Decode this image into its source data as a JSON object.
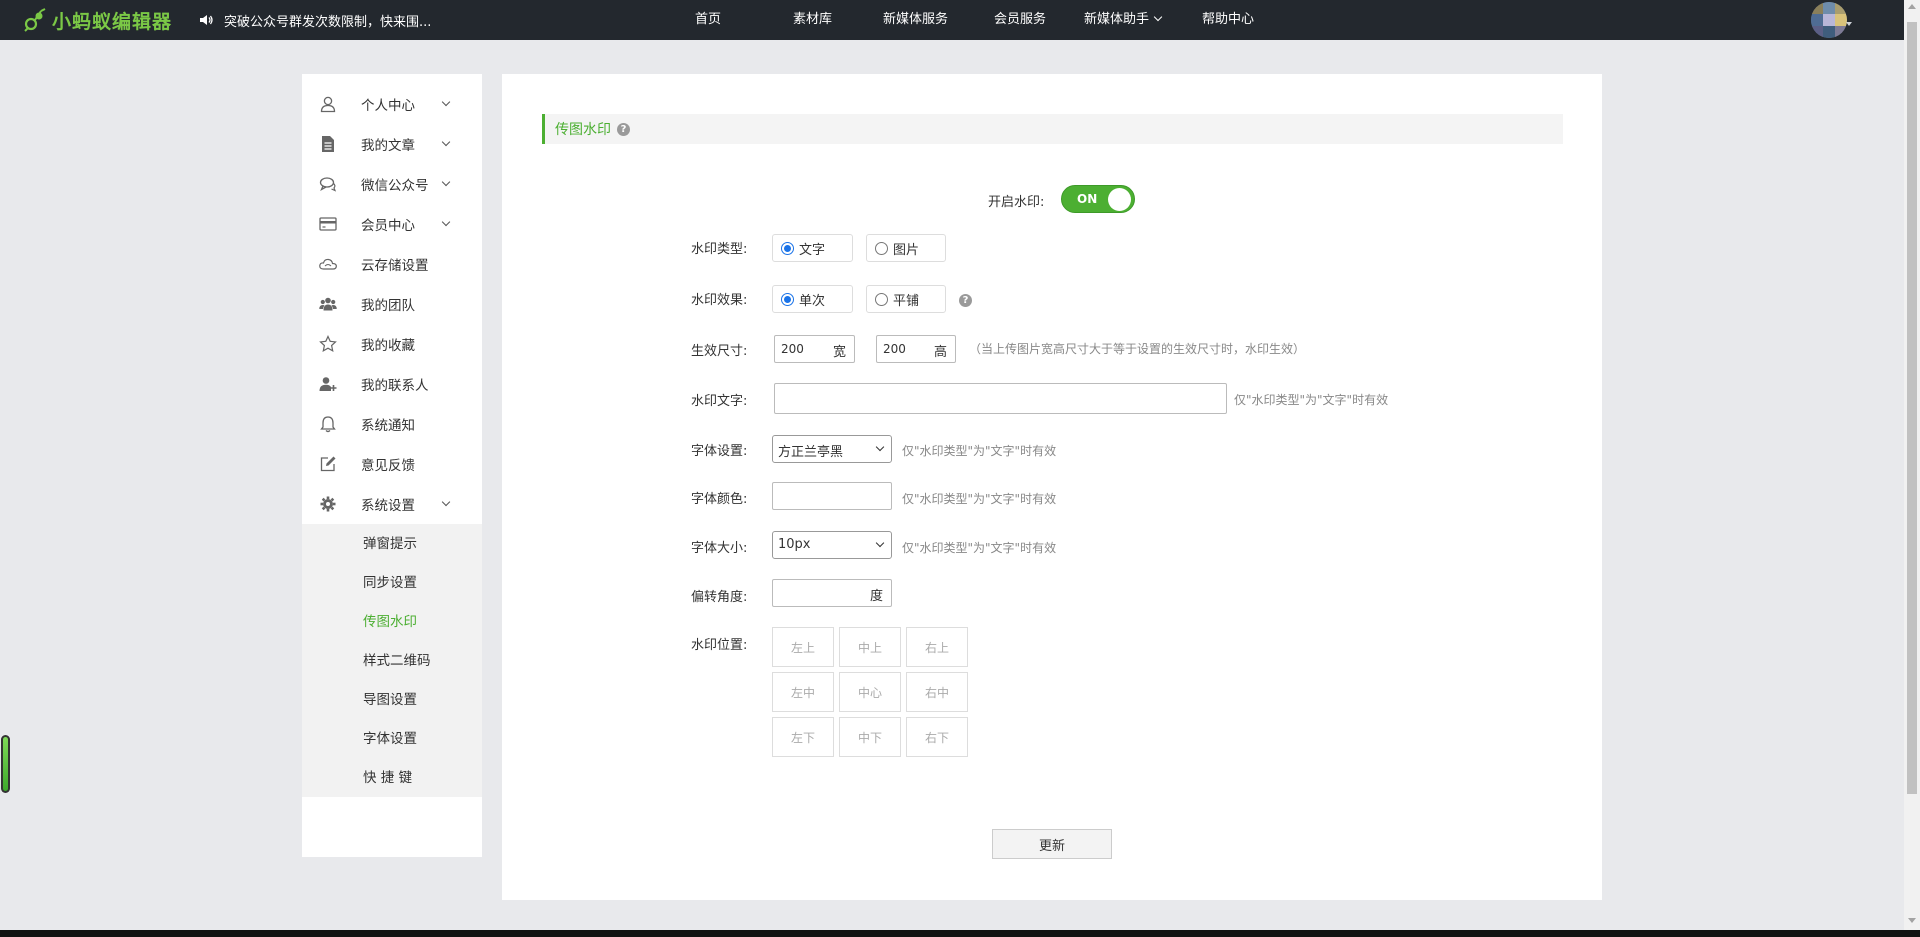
{
  "topbar": {
    "logo_text": "小蚂蚁编辑器",
    "notice": "突破公众号群发次数限制，快来围...",
    "nav": [
      {
        "label": "首页"
      },
      {
        "label": "素材库"
      },
      {
        "label": "新媒体服务"
      },
      {
        "label": "会员服务"
      },
      {
        "label": "新媒体助手"
      },
      {
        "label": "帮助中心"
      }
    ]
  },
  "sidebar": {
    "items": [
      {
        "label": "个人中心",
        "icon": "user-icon",
        "expandable": true
      },
      {
        "label": "我的文章",
        "icon": "document-icon",
        "expandable": true
      },
      {
        "label": "微信公众号",
        "icon": "chat-icon",
        "expandable": true
      },
      {
        "label": "会员中心",
        "icon": "card-icon",
        "expandable": true
      },
      {
        "label": "云存储设置",
        "icon": "cloud-icon",
        "expandable": false
      },
      {
        "label": "我的团队",
        "icon": "team-icon",
        "expandable": false
      },
      {
        "label": "我的收藏",
        "icon": "star-icon",
        "expandable": false
      },
      {
        "label": "我的联系人",
        "icon": "add-contact-icon",
        "expandable": false
      },
      {
        "label": "系统通知",
        "icon": "bell-icon",
        "expandable": false
      },
      {
        "label": "意见反馈",
        "icon": "edit-icon",
        "expandable": false
      },
      {
        "label": "系统设置",
        "icon": "gear-icon",
        "expandable": true
      }
    ],
    "subitems": [
      {
        "label": "弹窗提示"
      },
      {
        "label": "同步设置"
      },
      {
        "label": "传图水印",
        "active": true
      },
      {
        "label": "样式二维码"
      },
      {
        "label": "导图设置"
      },
      {
        "label": "字体设置"
      },
      {
        "label": "快 捷 键"
      }
    ]
  },
  "main": {
    "title": "传图水印",
    "enable_label": "开启水印:",
    "toggle_text": "ON",
    "toggle_on": true,
    "type_label": "水印类型:",
    "type_options": [
      "文字",
      "图片"
    ],
    "type_selected": "文字",
    "effect_label": "水印效果:",
    "effect_options": [
      "单次",
      "平铺"
    ],
    "effect_selected": "单次",
    "size_label": "生效尺寸:",
    "width_value": "200",
    "width_suffix": "宽",
    "height_value": "200",
    "height_suffix": "高",
    "size_hint": "（当上传图片宽高尺寸大于等于设置的生效尺寸时，水印生效）",
    "text_label": "水印文字:",
    "text_value": "",
    "text_hint": "仅\"水印类型\"为\"文字\"时有效",
    "font_label": "字体设置:",
    "font_value": "方正兰亭黑",
    "font_hint": "仅\"水印类型\"为\"文字\"时有效",
    "color_label": "字体颜色:",
    "color_value": "",
    "color_hint": "仅\"水印类型\"为\"文字\"时有效",
    "fontsize_label": "字体大小:",
    "fontsize_value": "10px",
    "fontsize_hint": "仅\"水印类型\"为\"文字\"时有效",
    "angle_label": "偏转角度:",
    "angle_value": "",
    "angle_suffix": "度",
    "position_label": "水印位置:",
    "positions": [
      "左上",
      "中上",
      "右上",
      "左中",
      "中心",
      "右中",
      "左下",
      "中下",
      "右下"
    ],
    "update_button": "更新"
  },
  "colors": {
    "topbar_bg": "#23282e",
    "accent_green": "#4caf32",
    "logo_green": "#7bc846",
    "page_bg": "#e8e9ec"
  }
}
